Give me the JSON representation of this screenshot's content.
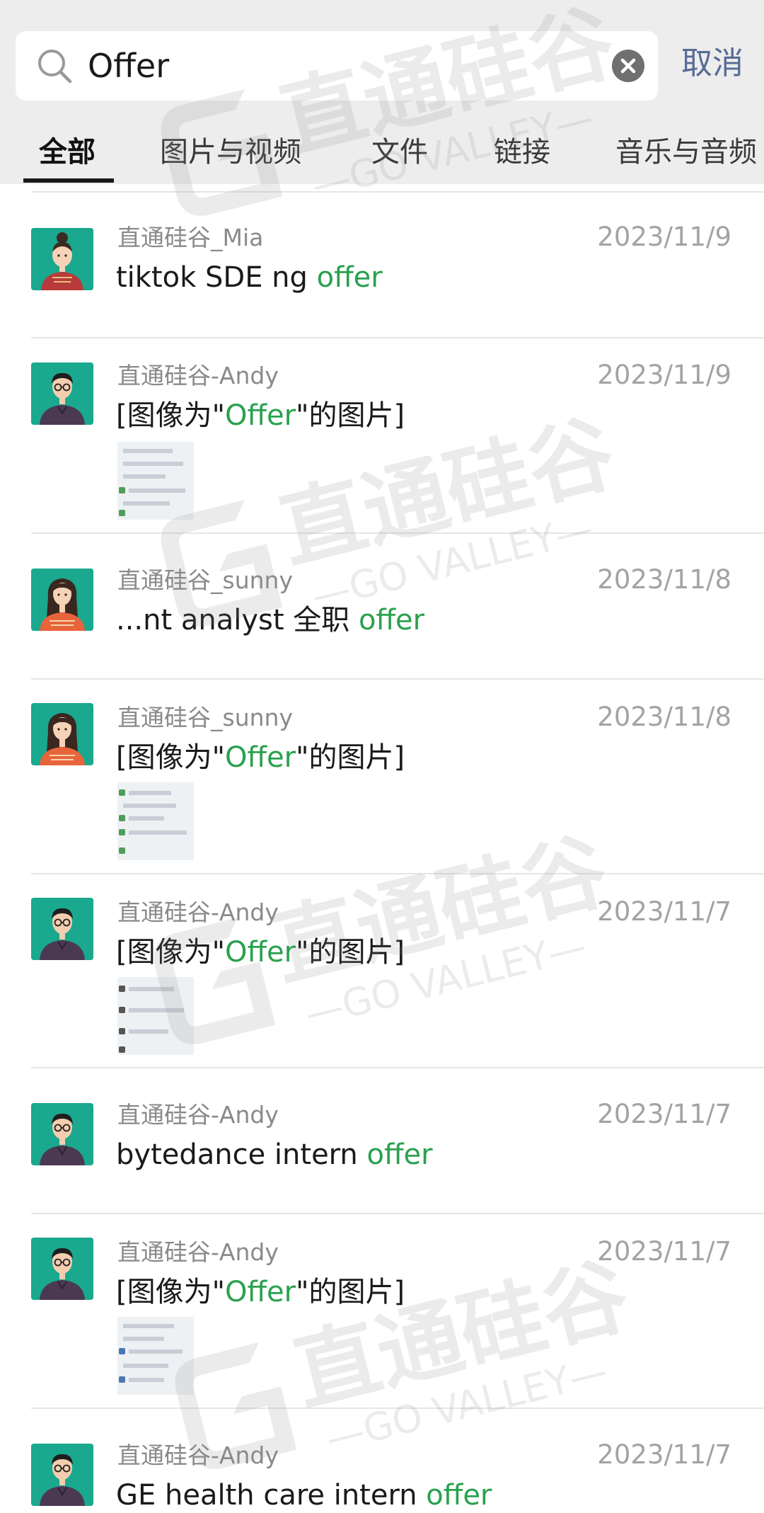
{
  "search": {
    "query": "Offer",
    "cancel_label": "取消"
  },
  "tabs": [
    {
      "label": "全部",
      "active": true
    },
    {
      "label": "图片与视频",
      "active": false
    },
    {
      "label": "文件",
      "active": false
    },
    {
      "label": "链接",
      "active": false
    },
    {
      "label": "音乐与音频",
      "active": false
    }
  ],
  "results": [
    {
      "sender": "直通硅谷_Mia",
      "date": "2023/11/9",
      "text_before": "tiktok SDE ng ",
      "highlight": "offer",
      "text_after": "",
      "has_image": false
    },
    {
      "sender": "直通硅谷-Andy",
      "date": "2023/11/9",
      "text_before": "[图像为\"",
      "highlight": "Offer",
      "text_after": "\"的图片]",
      "has_image": true
    },
    {
      "sender": "直通硅谷_sunny",
      "date": "2023/11/8",
      "text_before": "...nt analyst  全职 ",
      "highlight": "offer",
      "text_after": "",
      "has_image": false
    },
    {
      "sender": "直通硅谷_sunny",
      "date": "2023/11/8",
      "text_before": "[图像为\"",
      "highlight": "Offer",
      "text_after": "\"的图片]",
      "has_image": true
    },
    {
      "sender": "直通硅谷-Andy",
      "date": "2023/11/7",
      "text_before": "[图像为\"",
      "highlight": "Offer",
      "text_after": "\"的图片]",
      "has_image": true
    },
    {
      "sender": "直通硅谷-Andy",
      "date": "2023/11/7",
      "text_before": "bytedance intern ",
      "highlight": "offer",
      "text_after": "",
      "has_image": false
    },
    {
      "sender": "直通硅谷-Andy",
      "date": "2023/11/7",
      "text_before": "[图像为\"",
      "highlight": "Offer",
      "text_after": "\"的图片]",
      "has_image": true
    },
    {
      "sender": "直通硅谷-Andy",
      "date": "2023/11/7",
      "text_before": "GE health care intern ",
      "highlight": "offer",
      "text_after": "",
      "has_image": false
    }
  ],
  "watermark": {
    "brand": "直通硅谷",
    "tagline": "—GO VALLEY—"
  },
  "icons": {
    "search": "search-icon",
    "clear": "clear-icon",
    "avatar_mia": "avatar-woman-bun-red",
    "avatar_andy": "avatar-man-glasses-purple",
    "avatar_sunny": "avatar-woman-long-hair-orange"
  },
  "colors": {
    "highlight": "#2aa14e",
    "cancel": "#576b95",
    "header_bg": "#ededed",
    "avatar_bg": "#1aa88e"
  }
}
